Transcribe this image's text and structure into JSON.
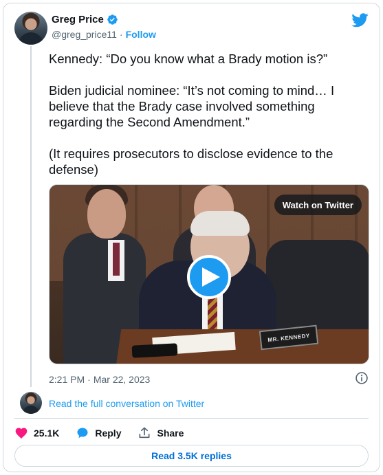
{
  "author": {
    "display_name": "Greg Price",
    "handle": "@greg_price11",
    "separator": "·",
    "follow_label": "Follow"
  },
  "tweet": {
    "paragraphs": [
      "Kennedy: “Do you know what a Brady motion is?”",
      "Biden judicial nominee: “It’s not coming to mind… I believe that the Brady case involved something regarding the Second Amendment.”",
      "(It requires prosecutors to disclose evidence to the defense)"
    ]
  },
  "media": {
    "watch_label": "Watch on Twitter",
    "nameplate_text": "MR. KENNEDY"
  },
  "meta": {
    "time": "2:21 PM",
    "separator": "·",
    "date": "Mar 22, 2023"
  },
  "conversation": {
    "link_text": "Read the full conversation on Twitter"
  },
  "actions": {
    "like_count": "25.1K",
    "reply_label": "Reply",
    "share_label": "Share"
  },
  "replies": {
    "button_label": "Read 3.5K replies"
  },
  "colors": {
    "accent": "#1d9bf0",
    "like": "#f91880",
    "text_secondary": "#536471",
    "border": "#cfd9de"
  },
  "icons": [
    "verified-badge-icon",
    "twitter-bird-icon",
    "play-icon",
    "info-icon",
    "heart-icon",
    "reply-bubble-icon",
    "share-icon"
  ]
}
